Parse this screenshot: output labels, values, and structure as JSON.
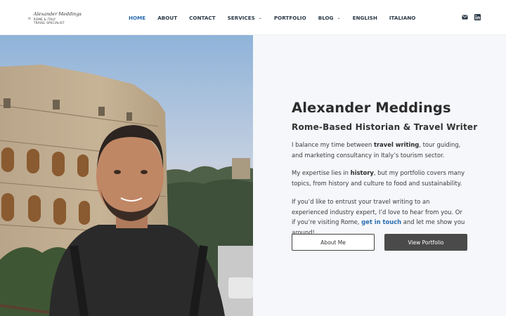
{
  "header": {
    "logo": {
      "name": "Alexander Meddings",
      "tagline_line1": "ROME & ITALY",
      "tagline_line2": "TRAVEL SPECIALIST"
    },
    "nav": [
      {
        "label": "Home",
        "active": true,
        "dropdown": false
      },
      {
        "label": "About",
        "active": false,
        "dropdown": false
      },
      {
        "label": "Contact",
        "active": false,
        "dropdown": false
      },
      {
        "label": "Services",
        "active": false,
        "dropdown": true
      },
      {
        "label": "Portfolio",
        "active": false,
        "dropdown": false
      },
      {
        "label": "Blog",
        "active": false,
        "dropdown": true
      },
      {
        "label": "English",
        "active": false,
        "dropdown": false
      },
      {
        "label": "Italiano",
        "active": false,
        "dropdown": false
      }
    ],
    "social_icons": [
      "mail-icon",
      "linkedin-icon"
    ]
  },
  "hero": {
    "image": "photo of a man in front of the Colosseum",
    "title": "Alexander Meddings",
    "subtitle": "Rome-Based Historian & Travel Writer",
    "p1": {
      "a": "I balance my time between ",
      "b": "travel writing",
      "c": ", tour guiding, and marketing consultancy in Italy’s tourism sector."
    },
    "p2": {
      "a": "My expertise lies in ",
      "b": "history",
      "c": ", but my portfolio covers many topics, from history and culture to food and sustainability."
    },
    "p3": {
      "a": "If you’d like to entrust your travel writing to an experienced industry expert, I’d love to hear from you. Or if you’re visiting Rome, ",
      "link": "get in touch",
      "c": " and let me show you around!"
    },
    "buttons": {
      "about": "About Me",
      "portfolio": "View Portfolio"
    }
  },
  "colors": {
    "accent": "#2b6cb0",
    "nav_text": "#2c3a48",
    "panel_bg": "#f5f7fa",
    "dark_button": "#4a4a4a"
  }
}
